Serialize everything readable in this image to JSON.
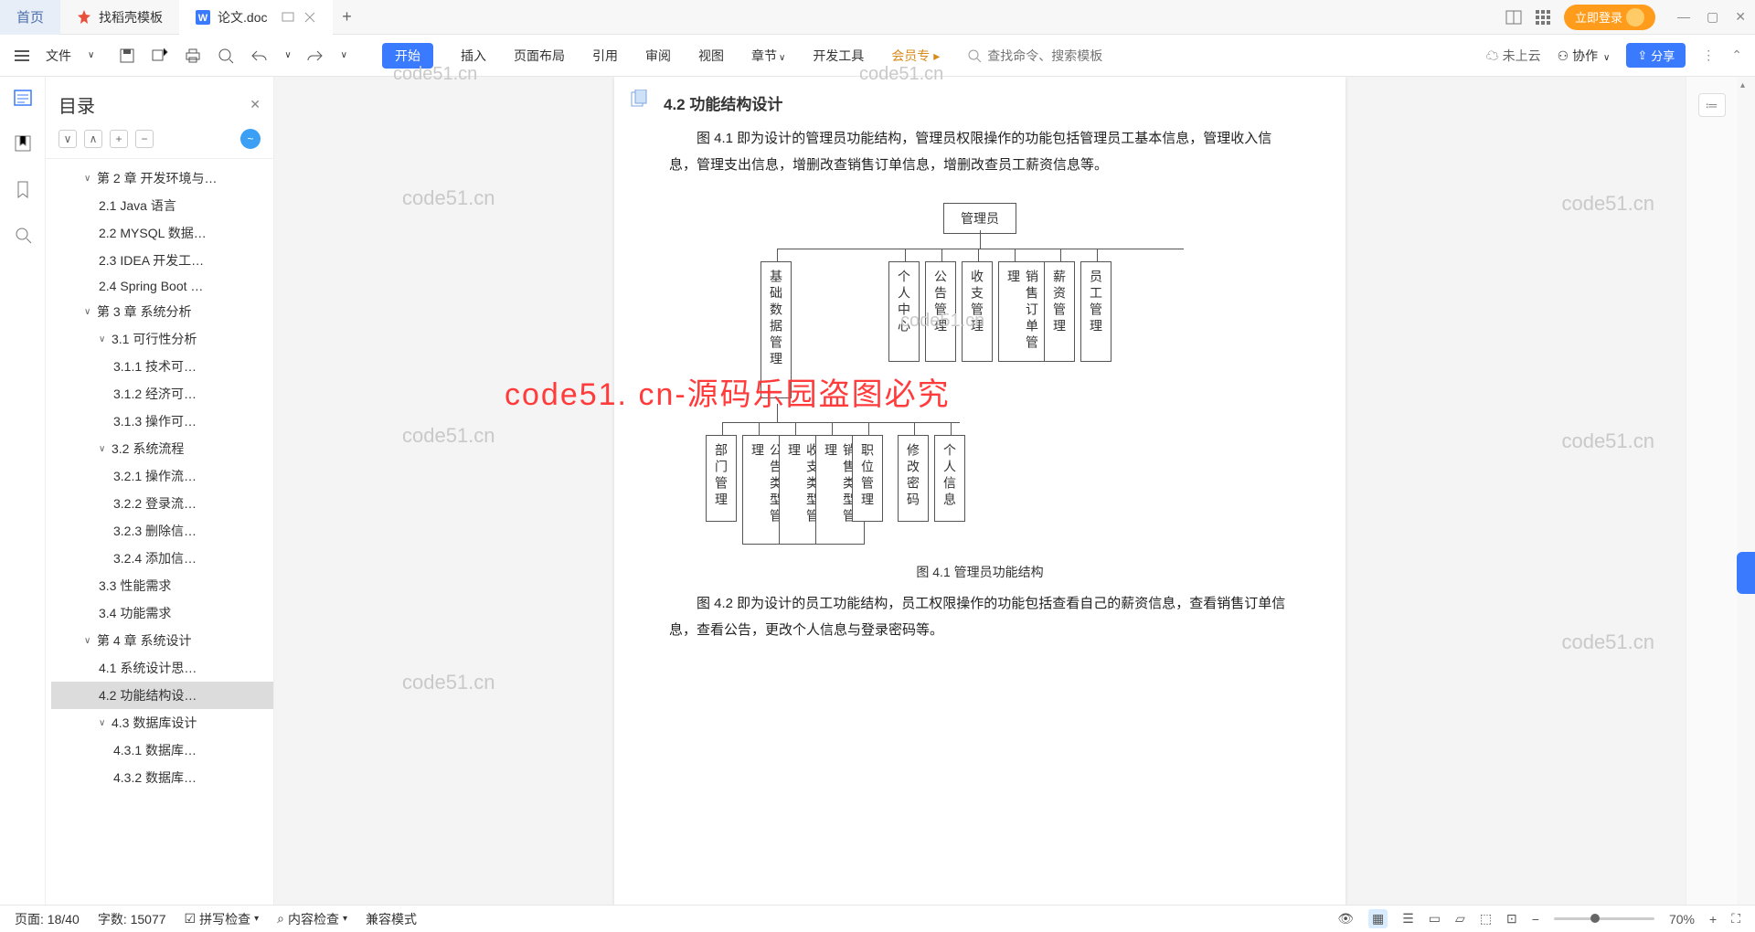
{
  "tabs": {
    "home": "首页",
    "t1": "找稻壳模板",
    "t2": "论文.doc"
  },
  "login": "立即登录",
  "file_label": "文件",
  "menu": {
    "start": "开始",
    "insert": "插入",
    "layout": "页面布局",
    "ref": "引用",
    "review": "审阅",
    "view": "视图",
    "section": "章节",
    "devtools": "开发工具",
    "vip": "会员专"
  },
  "search_placeholder": "查找命令、搜索模板",
  "cloud": "未上云",
  "collab": "协作",
  "share": "分享",
  "sidebar": {
    "title": "目录",
    "badge": "~",
    "items": [
      {
        "lvl": 2,
        "label": "第 2 章 开发环境与…",
        "chev": "∨"
      },
      {
        "lvl": 3,
        "label": "2.1 Java 语言"
      },
      {
        "lvl": 3,
        "label": "2.2 MYSQL 数据…"
      },
      {
        "lvl": 3,
        "label": "2.3 IDEA 开发工…"
      },
      {
        "lvl": 3,
        "label": "2.4 Spring Boot …"
      },
      {
        "lvl": 2,
        "label": "第 3 章 系统分析",
        "chev": "∨"
      },
      {
        "lvl": 3,
        "label": "3.1 可行性分析",
        "chev": "∨"
      },
      {
        "lvl": 4,
        "label": "3.1.1 技术可…"
      },
      {
        "lvl": 4,
        "label": "3.1.2 经济可…"
      },
      {
        "lvl": 4,
        "label": "3.1.3 操作可…"
      },
      {
        "lvl": 3,
        "label": "3.2 系统流程",
        "chev": "∨"
      },
      {
        "lvl": 4,
        "label": "3.2.1 操作流…"
      },
      {
        "lvl": 4,
        "label": "3.2.2 登录流…"
      },
      {
        "lvl": 4,
        "label": "3.2.3 删除信…"
      },
      {
        "lvl": 4,
        "label": "3.2.4 添加信…"
      },
      {
        "lvl": 3,
        "label": "3.3 性能需求"
      },
      {
        "lvl": 3,
        "label": "3.4 功能需求"
      },
      {
        "lvl": 2,
        "label": "第 4 章 系统设计",
        "chev": "∨"
      },
      {
        "lvl": 3,
        "label": "4.1 系统设计思…"
      },
      {
        "lvl": 3,
        "label": "4.2 功能结构设…",
        "selected": true
      },
      {
        "lvl": 3,
        "label": "4.3 数据库设计",
        "chev": "∨"
      },
      {
        "lvl": 4,
        "label": "4.3.1 数据库…"
      },
      {
        "lvl": 4,
        "label": "4.3.2 数据库…"
      }
    ]
  },
  "doc": {
    "heading": "4.2 功能结构设计",
    "p1": "图 4.1 即为设计的管理员功能结构，管理员权限操作的功能包括管理员工基本信息，管理收入信息，管理支出信息，增删改查销售订单信息，增删改查员工薪资信息等。",
    "fig1": "图 4.1 管理员功能结构",
    "p2": "图 4.2 即为设计的员工功能结构，员工权限操作的功能包括查看自己的薪资信息，查看销售订单信息，查看公告，更改个人信息与登录密码等。"
  },
  "chart_data": {
    "type": "tree",
    "root": "管理员",
    "level1": [
      "基础数据管理",
      "个人中心",
      "公告管理",
      "收支管理",
      "销售订单管理",
      "薪资管理",
      "员工管理"
    ],
    "level2_under_first": [
      "部门管理",
      "公告类型管理",
      "收支类型管理",
      "销售类型管理",
      "职位管理",
      "修改密码",
      "个人信息"
    ]
  },
  "status": {
    "page": "页面: 18/40",
    "words": "字数: 15077",
    "spell": "拼写检查",
    "content": "内容检查",
    "compat": "兼容模式",
    "zoom": "70%"
  },
  "watermark": "code51.cn",
  "watermark_red": "code51. cn-源码乐园盗图必究"
}
